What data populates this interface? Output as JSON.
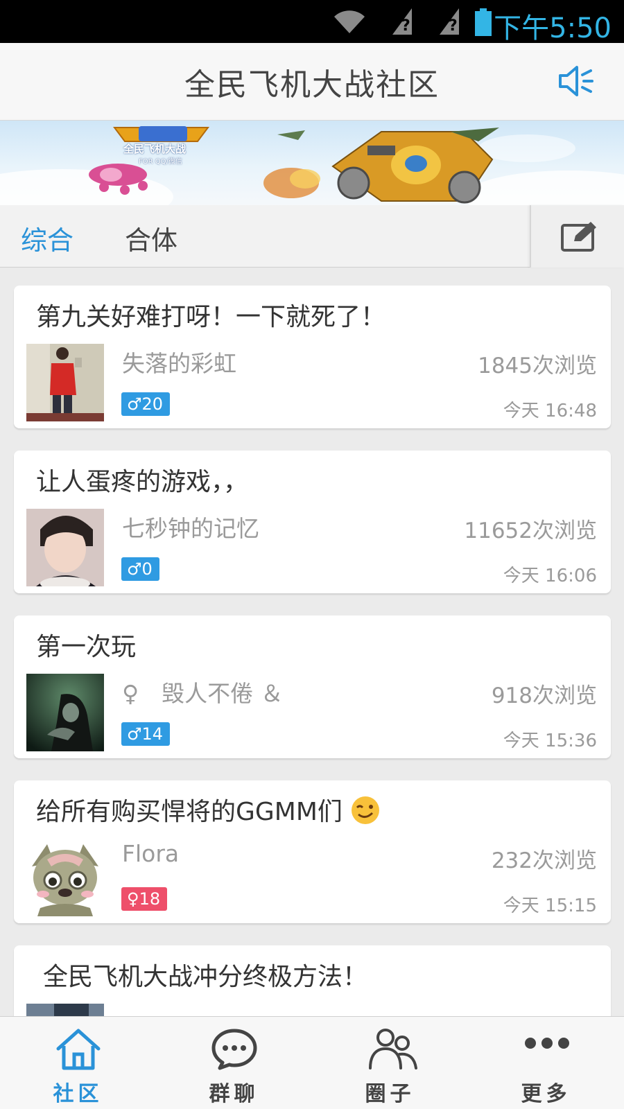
{
  "status_bar": {
    "time": "下午5:50"
  },
  "header": {
    "title": "全民飞机大战社区",
    "speaker_icon": "speaker-icon"
  },
  "banner": {
    "logo_text": "全民飞机大战",
    "sub_text": "FOR QQ/微信"
  },
  "tabs": [
    {
      "label": "综合",
      "active": true
    },
    {
      "label": "合体",
      "active": false
    }
  ],
  "compose_icon": "edit-icon",
  "posts": [
    {
      "title": "第九关好难打呀！一下就死了！",
      "author": "失落的彩虹",
      "views": "1845次浏览",
      "gender": "male",
      "badge": "20",
      "date": "今天 16:48"
    },
    {
      "title": "让人蛋疼的游戏，，",
      "author": "七秒钟的记忆",
      "views": "11652次浏览",
      "gender": "male",
      "badge": "0",
      "date": "今天 16:06"
    },
    {
      "title": "第一次玩",
      "author": "♀　毁人不倦 ＆",
      "views": "918次浏览",
      "gender": "male",
      "badge": "14",
      "date": "今天 15:36"
    },
    {
      "title": "给所有购买悍将的GGMM们",
      "author": "Flora",
      "views": "232次浏览",
      "gender": "female",
      "badge": "18",
      "date": "今天 15:15"
    },
    {
      "title": "全民飞机大战冲分终极方法！",
      "author": "",
      "views": "",
      "gender": "",
      "badge": "",
      "date": ""
    }
  ],
  "symbols": {
    "male": "♂",
    "female": "♀"
  },
  "colors": {
    "accent": "#2a92d8",
    "male": "#2f9be2",
    "female": "#ee4f6a"
  },
  "bottom_nav": [
    {
      "label": "社区",
      "icon": "home-icon",
      "active": true
    },
    {
      "label": "群聊",
      "icon": "chat-bubble-icon",
      "active": false
    },
    {
      "label": "圈子",
      "icon": "group-icon",
      "active": false
    },
    {
      "label": "更多",
      "icon": "more-icon",
      "active": false
    }
  ]
}
